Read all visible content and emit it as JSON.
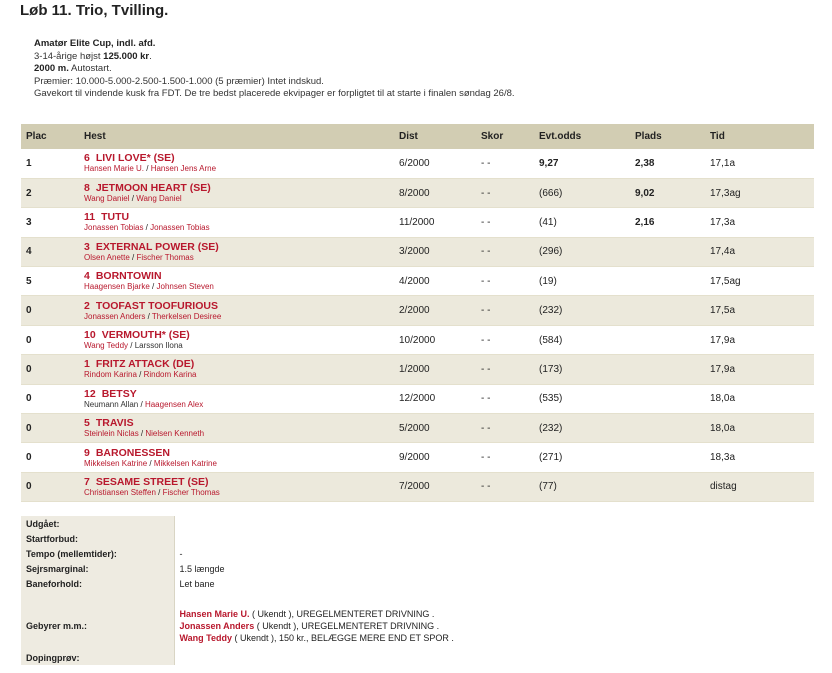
{
  "race": {
    "title": "Løb 11. Trio, Tvilling.",
    "name": "Amatør Elite Cup, indl. afd.",
    "cond_text": "3-14-årige højst ",
    "cond_amount": "125.000 kr",
    "cond_dot": ".",
    "distance": "2000 m.",
    "start": " Autostart.",
    "prizes": "Præmier: 10.000-5.000-2.500-1.500-1.000 (5 præmier) Intet indskud.",
    "note": "Gavekort til vindende kusk fra FDT. De tre bedst placerede ekvipager er forpligtet til at starte i finalen søndag 26/8."
  },
  "table": {
    "headers": [
      "Plac",
      "Hest",
      "Dist",
      "Skor",
      "Evt.odds",
      "Plads",
      "Tid"
    ],
    "rows": [
      {
        "plac": "1",
        "num": "6",
        "horse": "LIVI LOVE* (SE)",
        "driver": "Hansen Marie U.",
        "trainer": "Hansen Jens Arne",
        "driver_red": true,
        "trainer_red": true,
        "dist": "6/2000",
        "skor": "- -",
        "odds": "9,27",
        "odds_bold": true,
        "plads": "2,38",
        "tid": "17,1a"
      },
      {
        "plac": "2",
        "num": "8",
        "horse": "JETMOON HEART (SE)",
        "driver": "Wang Daniel",
        "trainer": "Wang Daniel",
        "driver_red": true,
        "trainer_red": true,
        "dist": "8/2000",
        "skor": "- -",
        "odds": "(666)",
        "odds_bold": false,
        "plads": "9,02",
        "tid": "17,3ag"
      },
      {
        "plac": "3",
        "num": "11",
        "horse": "TUTU",
        "driver": "Jonassen Tobias",
        "trainer": "Jonassen Tobias",
        "driver_red": true,
        "trainer_red": true,
        "dist": "11/2000",
        "skor": "- -",
        "odds": "(41)",
        "odds_bold": false,
        "plads": "2,16",
        "tid": "17,3a"
      },
      {
        "plac": "4",
        "num": "3",
        "horse": "EXTERNAL POWER (SE)",
        "driver": "Olsen Anette",
        "trainer": "Fischer Thomas",
        "driver_red": true,
        "trainer_red": true,
        "dist": "3/2000",
        "skor": "- -",
        "odds": "(296)",
        "odds_bold": false,
        "plads": "",
        "tid": "17,4a"
      },
      {
        "plac": "5",
        "num": "4",
        "horse": "BORNTOWIN",
        "driver": "Haagensen Bjarke",
        "trainer": "Johnsen Steven",
        "driver_red": true,
        "trainer_red": true,
        "dist": "4/2000",
        "skor": "- -",
        "odds": "(19)",
        "odds_bold": false,
        "plads": "",
        "tid": "17,5ag"
      },
      {
        "plac": "0",
        "num": "2",
        "horse": "TOOFAST TOOFURIOUS",
        "driver": "Jonassen Anders",
        "trainer": "Therkelsen Desiree",
        "driver_red": true,
        "trainer_red": true,
        "dist": "2/2000",
        "skor": "- -",
        "odds": "(232)",
        "odds_bold": false,
        "plads": "",
        "tid": "17,5a"
      },
      {
        "plac": "0",
        "num": "10",
        "horse": "VERMOUTH* (SE)",
        "driver": "Wang Teddy",
        "trainer": "Larsson Ilona",
        "driver_red": true,
        "trainer_red": false,
        "dist": "10/2000",
        "skor": "- -",
        "odds": "(584)",
        "odds_bold": false,
        "plads": "",
        "tid": "17,9a"
      },
      {
        "plac": "0",
        "num": "1",
        "horse": "FRITZ ATTACK (DE)",
        "driver": "Rindom Karina",
        "trainer": "Rindom Karina",
        "driver_red": true,
        "trainer_red": true,
        "dist": "1/2000",
        "skor": "- -",
        "odds": "(173)",
        "odds_bold": false,
        "plads": "",
        "tid": "17,9a"
      },
      {
        "plac": "0",
        "num": "12",
        "horse": "BETSY",
        "driver": "Neumann Allan",
        "trainer": "Haagensen Alex",
        "driver_red": false,
        "trainer_red": true,
        "dist": "12/2000",
        "skor": "- -",
        "odds": "(535)",
        "odds_bold": false,
        "plads": "",
        "tid": "18,0a"
      },
      {
        "plac": "0",
        "num": "5",
        "horse": "TRAVIS",
        "driver": "Steinlein Niclas",
        "trainer": "Nielsen Kenneth",
        "driver_red": true,
        "trainer_red": true,
        "dist": "5/2000",
        "skor": "- -",
        "odds": "(232)",
        "odds_bold": false,
        "plads": "",
        "tid": "18,0a"
      },
      {
        "plac": "0",
        "num": "9",
        "horse": "BARONESSEN",
        "driver": "Mikkelsen Katrine",
        "trainer": "Mikkelsen Katrine",
        "driver_red": true,
        "trainer_red": true,
        "dist": "9/2000",
        "skor": "- -",
        "odds": "(271)",
        "odds_bold": false,
        "plads": "",
        "tid": "18,3a"
      },
      {
        "plac": "0",
        "num": "7",
        "horse": "SESAME STREET (SE)",
        "driver": "Christiansen Steffen",
        "trainer": "Fischer Thomas",
        "driver_red": true,
        "trainer_red": true,
        "dist": "7/2000",
        "skor": "- -",
        "odds": "(77)",
        "odds_bold": false,
        "plads": "",
        "tid": "distag"
      }
    ]
  },
  "extra": {
    "udgaaet_label": "Udgået:",
    "startforbud_label": "Startforbud:",
    "tempo_label": "Tempo (mellemtider):",
    "tempo_value": "-",
    "sejr_label": "Sejrsmarginal:",
    "sejr_value": "1.5 længde",
    "bane_label": "Baneforhold:",
    "bane_value": "Let bane",
    "gebyr_label": "Gebyrer m.m.:",
    "gebyr": [
      {
        "name": "Hansen Marie U.",
        "rest": " ( Ukendt ), UREGELMENTERET DRIVNING ."
      },
      {
        "name": "Jonassen Anders",
        "rest": " ( Ukendt ), UREGELMENTERET DRIVNING ."
      },
      {
        "name": "Wang Teddy",
        "rest": " ( Ukendt ), 150 kr., BELÆGGE MERE END ET SPOR ."
      }
    ],
    "doping_label": "Dopingprøv:"
  }
}
